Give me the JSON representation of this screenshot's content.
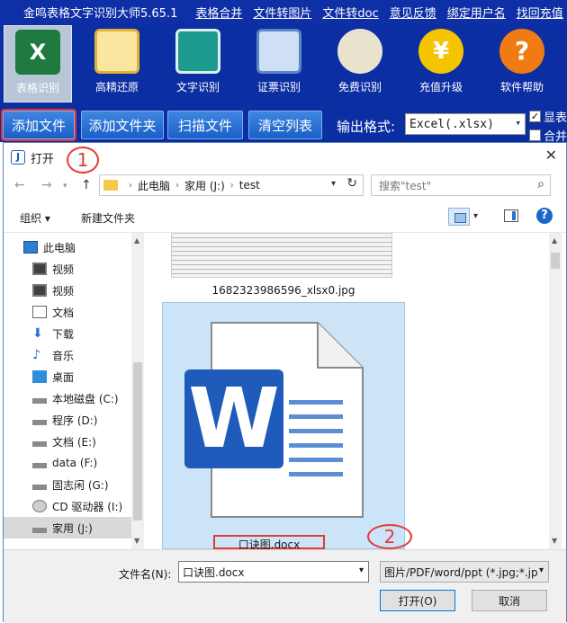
{
  "app": {
    "title": "金鸣表格文字识别大师5.65.1",
    "menu": [
      "表格合并",
      "文件转图片",
      "文件转doc",
      "意见反馈",
      "绑定用户名",
      "找回充值"
    ]
  },
  "ribbon": [
    {
      "label": "表格识别",
      "icon": "excel-icon",
      "active": true
    },
    {
      "label": "高精还原",
      "icon": "document-layout-icon"
    },
    {
      "label": "文字识别",
      "icon": "text-document-icon"
    },
    {
      "label": "证票识别",
      "icon": "id-card-icon"
    },
    {
      "label": "免费识别",
      "icon": "owl-book-icon"
    },
    {
      "label": "充值升级",
      "icon": "yuan-coin-icon"
    },
    {
      "label": "软件帮助",
      "icon": "question-icon"
    }
  ],
  "toolbar": {
    "add_file": "添加文件",
    "add_folder": "添加文件夹",
    "scan_file": "扫描文件",
    "clear_list": "清空列表",
    "format_label": "输出格式:",
    "format_value": "Excel(.xlsx)",
    "check1": "显表",
    "check2": "合并"
  },
  "dialog": {
    "title": "打开",
    "breadcrumb": [
      "此电脑",
      "家用 (J:)",
      "test"
    ],
    "search_placeholder": "搜索\"test\"",
    "organize": "组织",
    "new_folder": "新建文件夹",
    "nav_items": [
      {
        "label": "此电脑",
        "icon": "computer-icon"
      },
      {
        "label": "视频",
        "icon": "video-icon"
      },
      {
        "label": "视频",
        "icon": "video-icon"
      },
      {
        "label": "文档",
        "icon": "document-icon"
      },
      {
        "label": "下载",
        "icon": "download-icon"
      },
      {
        "label": "音乐",
        "icon": "music-icon"
      },
      {
        "label": "桌面",
        "icon": "desktop-icon"
      },
      {
        "label": "本地磁盘 (C:)",
        "icon": "drive-icon"
      },
      {
        "label": "程序 (D:)",
        "icon": "drive-icon"
      },
      {
        "label": "文档 (E:)",
        "icon": "drive-icon"
      },
      {
        "label": "data (F:)",
        "icon": "drive-icon"
      },
      {
        "label": "固志闲 (G:)",
        "icon": "drive-icon"
      },
      {
        "label": "CD 驱动器 (I:)",
        "icon": "cd-drive-icon"
      },
      {
        "label": "家用 (J:)",
        "icon": "drive-icon",
        "selected": true
      }
    ],
    "files": [
      {
        "name": "1682323986596_xlsx0.jpg"
      },
      {
        "name": "口诀图.docx",
        "selected": true
      }
    ],
    "filename_label": "文件名(N):",
    "filename_value": "口诀图.docx",
    "filetype": "图片/PDF/word/ppt (*.jpg;*.jp",
    "open_button": "打开(O)",
    "cancel_button": "取消"
  },
  "annotations": [
    "1",
    "2"
  ],
  "colors": {
    "accent": "#0c2ea3",
    "annotation": "#e53935",
    "word_blue": "#1f5bba"
  }
}
